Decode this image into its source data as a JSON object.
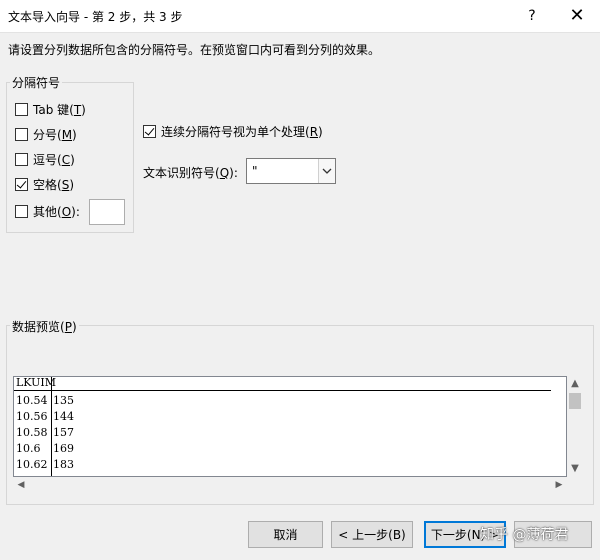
{
  "window": {
    "title": "文本导入向导 - 第 2 步，共 3 步",
    "help": "?",
    "close": "✕"
  },
  "instruction": "请设置分列数据所包含的分隔符号。在预览窗口内可看到分列的效果。",
  "delimiters": {
    "legend": "分隔符号",
    "tab": {
      "label": "Tab 键(",
      "key": "T",
      "tail": ")",
      "checked": false
    },
    "semicolon": {
      "label": "分号(",
      "key": "M",
      "tail": ")",
      "checked": false
    },
    "comma": {
      "label": "逗号(",
      "key": "C",
      "tail": ")",
      "checked": false
    },
    "space": {
      "label": "空格(",
      "key": "S",
      "tail": ")",
      "checked": true
    },
    "other": {
      "label": "其他(",
      "key": "O",
      "tail": "):",
      "checked": false,
      "value": ""
    }
  },
  "consecutive": {
    "label": "连续分隔符号视为单个处理(",
    "key": "R",
    "tail": ")",
    "checked": true
  },
  "text_qualifier": {
    "label": "文本识别符号(",
    "key": "Q",
    "tail": "):",
    "value": "\""
  },
  "preview": {
    "legend_prefix": "数据预览(",
    "legend_key": "P",
    "legend_tail": ")",
    "header": [
      "LKUIM",
      ""
    ],
    "rows": [
      [
        "10.54",
        "135"
      ],
      [
        "10.56",
        "144"
      ],
      [
        "10.58",
        "157"
      ],
      [
        "10.6",
        "169"
      ],
      [
        "10.62",
        "183"
      ]
    ]
  },
  "buttons": {
    "cancel": "取消",
    "back": "< 上一步(B)",
    "next": "下一步(N) >"
  },
  "watermark": "知乎 @薄荷君"
}
